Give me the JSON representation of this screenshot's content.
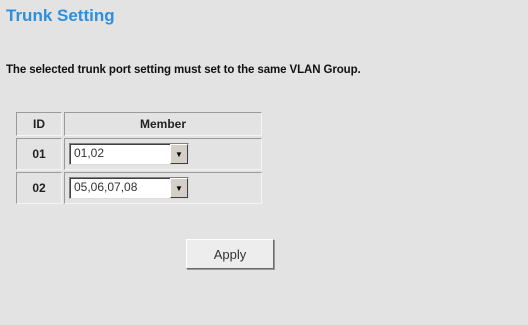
{
  "page": {
    "title": "Trunk Setting",
    "note": "The selected trunk port setting must set to the same VLAN Group."
  },
  "table": {
    "headers": {
      "id": "ID",
      "member": "Member"
    },
    "rows": [
      {
        "id": "01",
        "member": "01,02"
      },
      {
        "id": "02",
        "member": "05,06,07,08"
      }
    ]
  },
  "buttons": {
    "apply": "Apply"
  },
  "colors": {
    "title": "#2e8fdc",
    "background": "#e3e3e3"
  }
}
